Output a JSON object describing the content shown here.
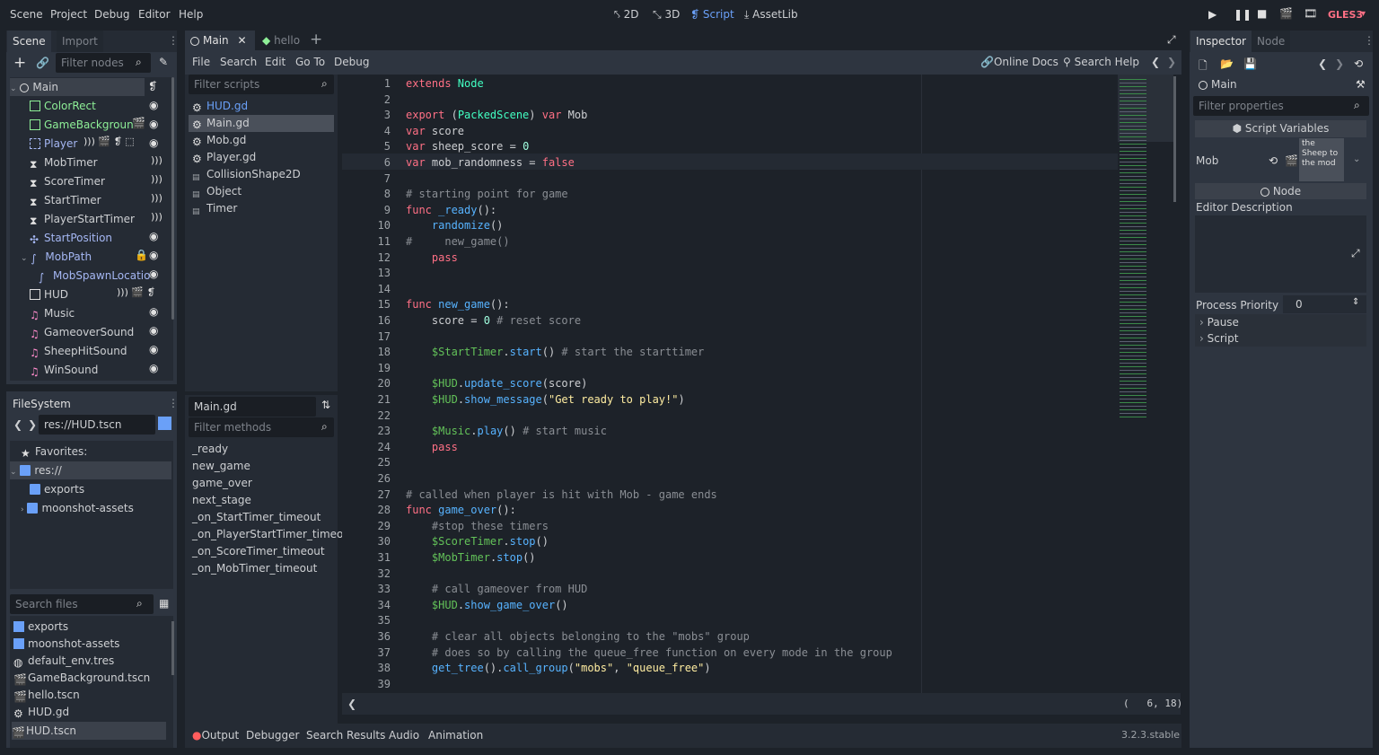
{
  "menu": [
    "Scene",
    "Project",
    "Debug",
    "Editor",
    "Help"
  ],
  "workspaces": [
    "2D",
    "3D",
    "Script",
    "AssetLib"
  ],
  "renderer": "GLES3",
  "scene_dock": {
    "tabs": [
      "Scene",
      "Import"
    ],
    "filter_placeholder": "Filter nodes",
    "nodes": [
      {
        "label": "Main",
        "depth": 0,
        "color": "#cdcfd2"
      },
      {
        "label": "ColorRect",
        "depth": 1,
        "color": "#8eef97"
      },
      {
        "label": "GameBackgroun",
        "depth": 1,
        "color": "#8eef97"
      },
      {
        "label": "Player",
        "depth": 1,
        "color": "#a5b7f3"
      },
      {
        "label": "MobTimer",
        "depth": 1,
        "color": "#cdcfd2"
      },
      {
        "label": "ScoreTimer",
        "depth": 1,
        "color": "#cdcfd2"
      },
      {
        "label": "StartTimer",
        "depth": 1,
        "color": "#cdcfd2"
      },
      {
        "label": "PlayerStartTimer",
        "depth": 1,
        "color": "#cdcfd2"
      },
      {
        "label": "StartPosition",
        "depth": 1,
        "color": "#a5b7f3"
      },
      {
        "label": "MobPath",
        "depth": 1,
        "color": "#a5b7f3"
      },
      {
        "label": "MobSpawnLocatio",
        "depth": 2,
        "color": "#a5b7f3"
      },
      {
        "label": "HUD",
        "depth": 1,
        "color": "#cdcfd2"
      },
      {
        "label": "Music",
        "depth": 1,
        "color": "#ff8ccc"
      },
      {
        "label": "GameoverSound",
        "depth": 1,
        "color": "#ff8ccc"
      },
      {
        "label": "SheepHitSound",
        "depth": 1,
        "color": "#ff8ccc"
      },
      {
        "label": "WinSound",
        "depth": 1,
        "color": "#ff8ccc"
      }
    ]
  },
  "filesystem": {
    "tab": "FileSystem",
    "path": "res://HUD.tscn",
    "tree": [
      "Favorites:",
      "res://",
      "exports",
      "moonshot-assets"
    ],
    "search_placeholder": "Search files",
    "files": [
      "exports",
      "moonshot-assets",
      "default_env.tres",
      "GameBackground.tscn",
      "hello.tscn",
      "HUD.gd",
      "HUD.tscn"
    ]
  },
  "script_tabs": [
    "Main",
    "hello"
  ],
  "script_menu": [
    "File",
    "Search",
    "Edit",
    "Go To",
    "Debug"
  ],
  "script_links": [
    "Online Docs",
    "Search Help"
  ],
  "scripts": {
    "filter_placeholder": "Filter scripts",
    "items": [
      "HUD.gd",
      "Main.gd",
      "Mob.gd",
      "Player.gd",
      "CollisionShape2D",
      "Object",
      "Timer"
    ]
  },
  "methods": {
    "title": "Main.gd",
    "filter_placeholder": "Filter methods",
    "items": [
      "_ready",
      "new_game",
      "game_over",
      "next_stage",
      "_on_StartTimer_timeout",
      "_on_PlayerStartTimer_timeout",
      "_on_ScoreTimer_timeout",
      "_on_MobTimer_timeout"
    ]
  },
  "code": {
    "lines": [
      [
        [
          "kw",
          "extends "
        ],
        [
          "ty",
          "Node"
        ]
      ],
      [],
      [
        [
          "kw",
          "export "
        ],
        [
          "tx",
          "("
        ],
        [
          "ty",
          "PackedScene"
        ],
        [
          "tx",
          ") "
        ],
        [
          "kw",
          "var "
        ],
        [
          "tx",
          "Mob"
        ]
      ],
      [
        [
          "kw",
          "var "
        ],
        [
          "tx",
          "score"
        ]
      ],
      [
        [
          "kw",
          "var "
        ],
        [
          "tx",
          "sheep_score = "
        ],
        [
          "nu",
          "0"
        ]
      ],
      [
        [
          "kw",
          "var "
        ],
        [
          "tx",
          "mob_randomness = "
        ],
        [
          "kw",
          "false"
        ]
      ],
      [],
      [
        [
          "cm",
          "# starting point for game"
        ]
      ],
      [
        [
          "kw",
          "func "
        ],
        [
          "fn",
          "_ready"
        ],
        [
          "tx",
          "():"
        ]
      ],
      [
        [
          "tx",
          "    "
        ],
        [
          "fn",
          "randomize"
        ],
        [
          "tx",
          "()"
        ]
      ],
      [
        [
          "cm",
          "#     new_game()"
        ]
      ],
      [
        [
          "tx",
          "    "
        ],
        [
          "kw",
          "pass"
        ]
      ],
      [],
      [],
      [
        [
          "kw",
          "func "
        ],
        [
          "fn",
          "new_game"
        ],
        [
          "tx",
          "():"
        ]
      ],
      [
        [
          "tx",
          "    score = "
        ],
        [
          "nu",
          "0"
        ],
        [
          "cm",
          " # reset score"
        ]
      ],
      [],
      [
        [
          "tx",
          "    "
        ],
        [
          "nd",
          "$StartTimer"
        ],
        [
          "tx",
          "."
        ],
        [
          "fn",
          "start"
        ],
        [
          "tx",
          "()"
        ],
        [
          "cm",
          " # start the starttimer"
        ]
      ],
      [],
      [
        [
          "tx",
          "    "
        ],
        [
          "nd",
          "$HUD"
        ],
        [
          "tx",
          "."
        ],
        [
          "fn",
          "update_score"
        ],
        [
          "tx",
          "(score)"
        ]
      ],
      [
        [
          "tx",
          "    "
        ],
        [
          "nd",
          "$HUD"
        ],
        [
          "tx",
          "."
        ],
        [
          "fn",
          "show_message"
        ],
        [
          "tx",
          "("
        ],
        [
          "st",
          "\"Get ready to play!\""
        ],
        [
          "tx",
          ")"
        ]
      ],
      [],
      [
        [
          "tx",
          "    "
        ],
        [
          "nd",
          "$Music"
        ],
        [
          "tx",
          "."
        ],
        [
          "fn",
          "play"
        ],
        [
          "tx",
          "()"
        ],
        [
          "cm",
          " # start music"
        ]
      ],
      [
        [
          "tx",
          "    "
        ],
        [
          "kw",
          "pass"
        ]
      ],
      [],
      [],
      [
        [
          "cm",
          "# called when player is hit with Mob - game ends"
        ]
      ],
      [
        [
          "kw",
          "func "
        ],
        [
          "fn",
          "game_over"
        ],
        [
          "tx",
          "():"
        ]
      ],
      [
        [
          "cm",
          "    #stop these timers"
        ]
      ],
      [
        [
          "tx",
          "    "
        ],
        [
          "nd",
          "$ScoreTimer"
        ],
        [
          "tx",
          "."
        ],
        [
          "fn",
          "stop"
        ],
        [
          "tx",
          "()"
        ]
      ],
      [
        [
          "tx",
          "    "
        ],
        [
          "nd",
          "$MobTimer"
        ],
        [
          "tx",
          "."
        ],
        [
          "fn",
          "stop"
        ],
        [
          "tx",
          "()"
        ]
      ],
      [],
      [
        [
          "cm",
          "    # call gameover from HUD"
        ]
      ],
      [
        [
          "tx",
          "    "
        ],
        [
          "nd",
          "$HUD"
        ],
        [
          "tx",
          "."
        ],
        [
          "fn",
          "show_game_over"
        ],
        [
          "tx",
          "()"
        ]
      ],
      [],
      [
        [
          "cm",
          "    # clear all objects belonging to the \"mobs\" group"
        ]
      ],
      [
        [
          "cm",
          "    # does so by calling the queue_free function on every mode in the group"
        ]
      ],
      [
        [
          "tx",
          "    "
        ],
        [
          "fn",
          "get_tree"
        ],
        [
          "tx",
          "()."
        ],
        [
          "fn",
          "call_group"
        ],
        [
          "tx",
          "("
        ],
        [
          "st",
          "\"mobs\""
        ],
        [
          "tx",
          ", "
        ],
        [
          "st",
          "\"queue_free\""
        ],
        [
          "tx",
          ")"
        ]
      ],
      []
    ],
    "cursor": "(   6, 18)"
  },
  "bottom_tabs": [
    "Output",
    "Debugger",
    "Search Results",
    "Audio",
    "Animation"
  ],
  "version": "3.2.3.stable",
  "inspector": {
    "tabs": [
      "Inspector",
      "Node"
    ],
    "object": "Main",
    "filter_placeholder": "Filter properties",
    "section": "Script Variables",
    "mob_label": "Mob",
    "mob_preview": "the Sheep to the mod",
    "node_section": "Node",
    "editor_description": "Editor Description",
    "process_priority_label": "Process Priority",
    "process_priority_value": "0",
    "groups": [
      "Pause",
      "Script"
    ]
  }
}
